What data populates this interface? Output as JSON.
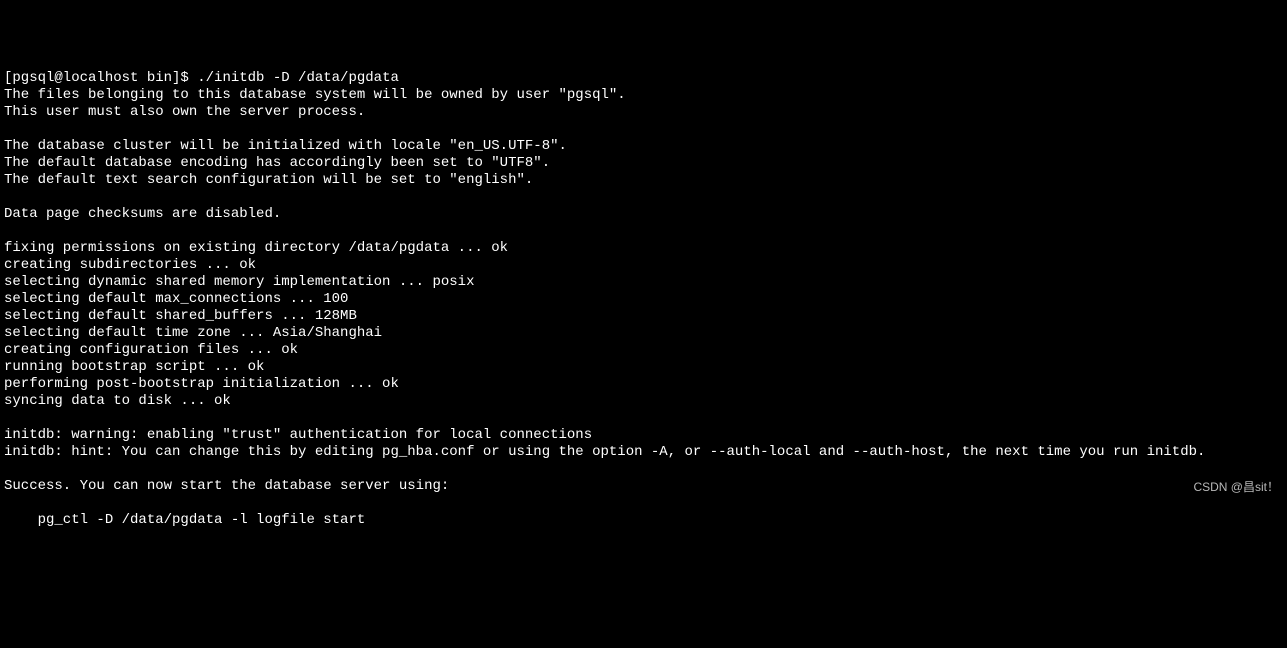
{
  "terminal": {
    "prompt": "[pgsql@localhost bin]$ ",
    "command": "./initdb -D /data/pgdata",
    "lines": [
      "The files belonging to this database system will be owned by user \"pgsql\".",
      "This user must also own the server process.",
      "",
      "The database cluster will be initialized with locale \"en_US.UTF-8\".",
      "The default database encoding has accordingly been set to \"UTF8\".",
      "The default text search configuration will be set to \"english\".",
      "",
      "Data page checksums are disabled.",
      "",
      "fixing permissions on existing directory /data/pgdata ... ok",
      "creating subdirectories ... ok",
      "selecting dynamic shared memory implementation ... posix",
      "selecting default max_connections ... 100",
      "selecting default shared_buffers ... 128MB",
      "selecting default time zone ... Asia/Shanghai",
      "creating configuration files ... ok",
      "running bootstrap script ... ok",
      "performing post-bootstrap initialization ... ok",
      "syncing data to disk ... ok",
      "",
      "initdb: warning: enabling \"trust\" authentication for local connections",
      "initdb: hint: You can change this by editing pg_hba.conf or using the option -A, or --auth-local and --auth-host, the next time you run initdb.",
      "",
      "Success. You can now start the database server using:",
      "",
      "    pg_ctl -D /data/pgdata -l logfile start",
      ""
    ]
  },
  "watermark": "CSDN @昌sit！"
}
